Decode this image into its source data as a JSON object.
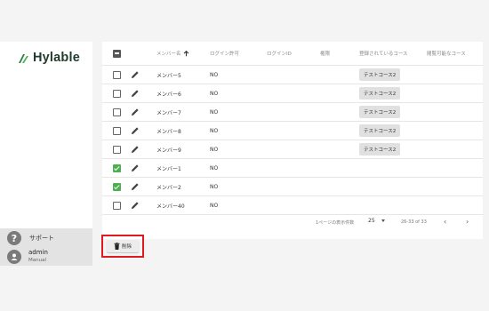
{
  "app": {
    "logo_text": "Hylable",
    "brand_color": "#2e7d46"
  },
  "sidebar": {
    "support_label": "サポート",
    "support_icon": "help-circle-icon",
    "user_name": "admin",
    "user_role": "Manual",
    "user_icon": "account-circle-icon"
  },
  "table": {
    "headers": {
      "name": "メンバー名",
      "name_sort_icon": "arrow-up-icon",
      "login_permission": "ログイン許可",
      "login_id": "ログインID",
      "role": "権限",
      "registered_courses": "登録されているコース",
      "public_courses": "閲覧可能なコース"
    },
    "rows": [
      {
        "checked": false,
        "name": "メンバー5",
        "login_permission": "NO",
        "course": "テストコース2"
      },
      {
        "checked": false,
        "name": "メンバー6",
        "login_permission": "NO",
        "course": "テストコース2"
      },
      {
        "checked": false,
        "name": "メンバー7",
        "login_permission": "NO",
        "course": "テストコース2"
      },
      {
        "checked": false,
        "name": "メンバー8",
        "login_permission": "NO",
        "course": "テストコース2"
      },
      {
        "checked": false,
        "name": "メンバー9",
        "login_permission": "NO",
        "course": "テストコース2"
      },
      {
        "checked": true,
        "name": "メンバー1",
        "login_permission": "NO",
        "course": ""
      },
      {
        "checked": true,
        "name": "メンバー2",
        "login_permission": "NO",
        "course": ""
      },
      {
        "checked": false,
        "name": "メンバー40",
        "login_permission": "NO",
        "course": ""
      }
    ],
    "check_color": "#4caf50"
  },
  "pagination": {
    "rows_per_page_label": "1ページの表示件数",
    "rows_per_page_value": "25",
    "range_text": "26-33 of 33",
    "prev_icon": "chevron-left-icon",
    "next_icon": "chevron-right-icon"
  },
  "actions": {
    "delete_label": "削除",
    "delete_icon": "trash-icon",
    "highlight_color": "#e0191f"
  }
}
